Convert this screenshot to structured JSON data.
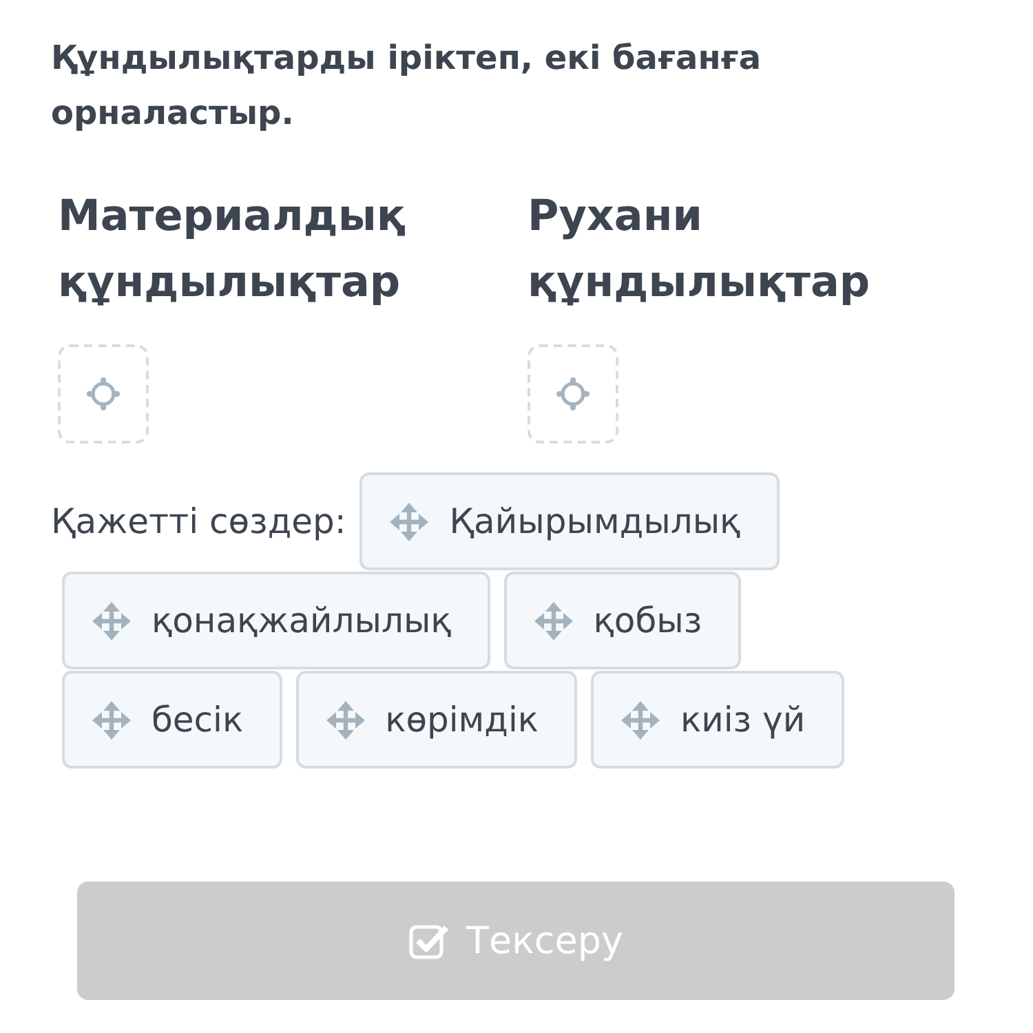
{
  "instruction": "Құндылықтарды іріктеп, екі бағанға орналастыр.",
  "columns": [
    {
      "heading": "Материалдық құндылықтар"
    },
    {
      "heading": "Рухани құндылықтар"
    }
  ],
  "word_bank": {
    "label": "Қажетті сөздер:",
    "words": [
      "Қайырымдылық",
      "қонақжайлылық",
      "қобыз",
      "бесік",
      "көрімдік",
      "киіз үй"
    ]
  },
  "check_button": {
    "label": "Тексеру",
    "disabled": true
  }
}
